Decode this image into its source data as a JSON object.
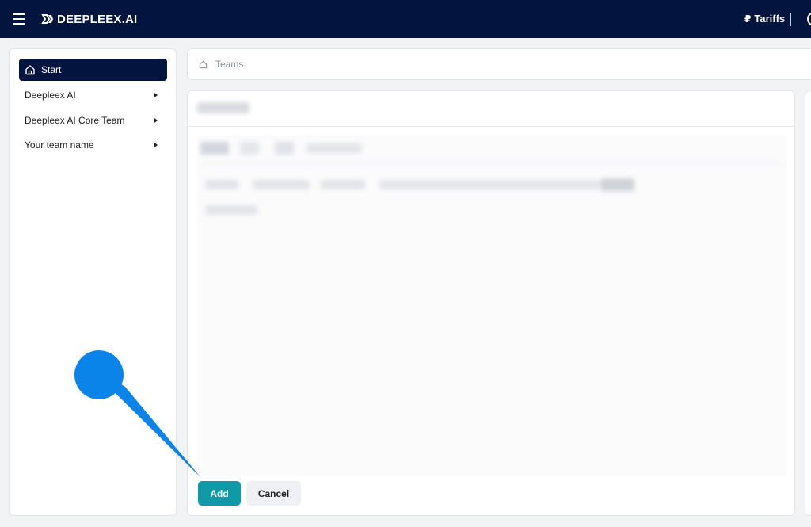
{
  "header": {
    "logo_text": "DEEPLEEX.AI",
    "tariffs_currency": "₽",
    "tariffs_label": "Tariffs"
  },
  "sidebar": {
    "items": [
      {
        "label": "Start",
        "active": true
      },
      {
        "label": "Deepleex AI"
      },
      {
        "label": "Deepleex AI Core Team"
      },
      {
        "label": "Your team name"
      }
    ]
  },
  "breadcrumb": {
    "label": "Teams"
  },
  "actions": {
    "add_label": "Add",
    "cancel_label": "Cancel"
  },
  "colors": {
    "header_bg": "#03143f",
    "add_button": "#0e9aa7",
    "pointer": "#0a84e8"
  },
  "icons": [
    "menu-icon",
    "logo-icon",
    "home-icon",
    "chevron-right-icon"
  ]
}
